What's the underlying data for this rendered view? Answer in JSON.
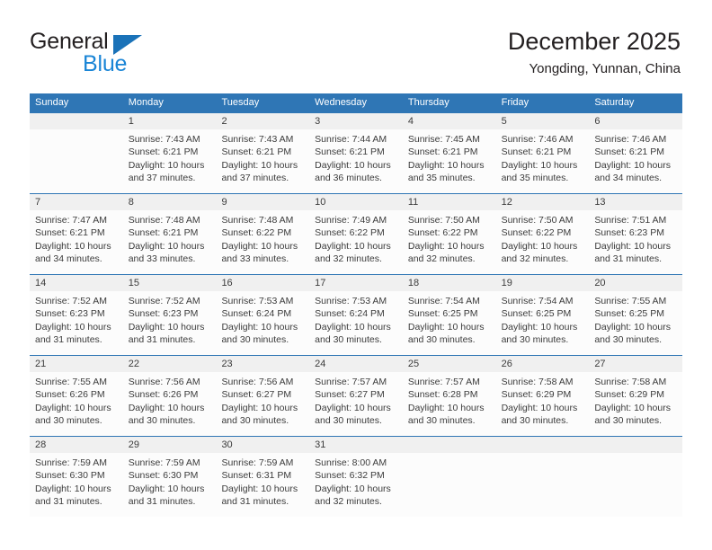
{
  "brand": {
    "name_part1": "General",
    "name_part2": "Blue",
    "triangle_color": "#1a72b8",
    "blue_color": "#1a85d6"
  },
  "header": {
    "title": "December 2025",
    "subtitle": "Yongding, Yunnan, China"
  },
  "theme": {
    "header_bg": "#2f76b5",
    "daynum_bg": "#f0f0f0",
    "cell_bg": "#fcfcfc",
    "text_color": "#3b3b3b"
  },
  "weekdays": [
    "Sunday",
    "Monday",
    "Tuesday",
    "Wednesday",
    "Thursday",
    "Friday",
    "Saturday"
  ],
  "weeks": [
    {
      "days": [
        {
          "number": "",
          "sunrise": "",
          "sunset": "",
          "daylight_line1": "",
          "daylight_line2": ""
        },
        {
          "number": "1",
          "sunrise": "Sunrise: 7:43 AM",
          "sunset": "Sunset: 6:21 PM",
          "daylight_line1": "Daylight: 10 hours",
          "daylight_line2": "and 37 minutes."
        },
        {
          "number": "2",
          "sunrise": "Sunrise: 7:43 AM",
          "sunset": "Sunset: 6:21 PM",
          "daylight_line1": "Daylight: 10 hours",
          "daylight_line2": "and 37 minutes."
        },
        {
          "number": "3",
          "sunrise": "Sunrise: 7:44 AM",
          "sunset": "Sunset: 6:21 PM",
          "daylight_line1": "Daylight: 10 hours",
          "daylight_line2": "and 36 minutes."
        },
        {
          "number": "4",
          "sunrise": "Sunrise: 7:45 AM",
          "sunset": "Sunset: 6:21 PM",
          "daylight_line1": "Daylight: 10 hours",
          "daylight_line2": "and 35 minutes."
        },
        {
          "number": "5",
          "sunrise": "Sunrise: 7:46 AM",
          "sunset": "Sunset: 6:21 PM",
          "daylight_line1": "Daylight: 10 hours",
          "daylight_line2": "and 35 minutes."
        },
        {
          "number": "6",
          "sunrise": "Sunrise: 7:46 AM",
          "sunset": "Sunset: 6:21 PM",
          "daylight_line1": "Daylight: 10 hours",
          "daylight_line2": "and 34 minutes."
        }
      ]
    },
    {
      "days": [
        {
          "number": "7",
          "sunrise": "Sunrise: 7:47 AM",
          "sunset": "Sunset: 6:21 PM",
          "daylight_line1": "Daylight: 10 hours",
          "daylight_line2": "and 34 minutes."
        },
        {
          "number": "8",
          "sunrise": "Sunrise: 7:48 AM",
          "sunset": "Sunset: 6:21 PM",
          "daylight_line1": "Daylight: 10 hours",
          "daylight_line2": "and 33 minutes."
        },
        {
          "number": "9",
          "sunrise": "Sunrise: 7:48 AM",
          "sunset": "Sunset: 6:22 PM",
          "daylight_line1": "Daylight: 10 hours",
          "daylight_line2": "and 33 minutes."
        },
        {
          "number": "10",
          "sunrise": "Sunrise: 7:49 AM",
          "sunset": "Sunset: 6:22 PM",
          "daylight_line1": "Daylight: 10 hours",
          "daylight_line2": "and 32 minutes."
        },
        {
          "number": "11",
          "sunrise": "Sunrise: 7:50 AM",
          "sunset": "Sunset: 6:22 PM",
          "daylight_line1": "Daylight: 10 hours",
          "daylight_line2": "and 32 minutes."
        },
        {
          "number": "12",
          "sunrise": "Sunrise: 7:50 AM",
          "sunset": "Sunset: 6:22 PM",
          "daylight_line1": "Daylight: 10 hours",
          "daylight_line2": "and 32 minutes."
        },
        {
          "number": "13",
          "sunrise": "Sunrise: 7:51 AM",
          "sunset": "Sunset: 6:23 PM",
          "daylight_line1": "Daylight: 10 hours",
          "daylight_line2": "and 31 minutes."
        }
      ]
    },
    {
      "days": [
        {
          "number": "14",
          "sunrise": "Sunrise: 7:52 AM",
          "sunset": "Sunset: 6:23 PM",
          "daylight_line1": "Daylight: 10 hours",
          "daylight_line2": "and 31 minutes."
        },
        {
          "number": "15",
          "sunrise": "Sunrise: 7:52 AM",
          "sunset": "Sunset: 6:23 PM",
          "daylight_line1": "Daylight: 10 hours",
          "daylight_line2": "and 31 minutes."
        },
        {
          "number": "16",
          "sunrise": "Sunrise: 7:53 AM",
          "sunset": "Sunset: 6:24 PM",
          "daylight_line1": "Daylight: 10 hours",
          "daylight_line2": "and 30 minutes."
        },
        {
          "number": "17",
          "sunrise": "Sunrise: 7:53 AM",
          "sunset": "Sunset: 6:24 PM",
          "daylight_line1": "Daylight: 10 hours",
          "daylight_line2": "and 30 minutes."
        },
        {
          "number": "18",
          "sunrise": "Sunrise: 7:54 AM",
          "sunset": "Sunset: 6:25 PM",
          "daylight_line1": "Daylight: 10 hours",
          "daylight_line2": "and 30 minutes."
        },
        {
          "number": "19",
          "sunrise": "Sunrise: 7:54 AM",
          "sunset": "Sunset: 6:25 PM",
          "daylight_line1": "Daylight: 10 hours",
          "daylight_line2": "and 30 minutes."
        },
        {
          "number": "20",
          "sunrise": "Sunrise: 7:55 AM",
          "sunset": "Sunset: 6:25 PM",
          "daylight_line1": "Daylight: 10 hours",
          "daylight_line2": "and 30 minutes."
        }
      ]
    },
    {
      "days": [
        {
          "number": "21",
          "sunrise": "Sunrise: 7:55 AM",
          "sunset": "Sunset: 6:26 PM",
          "daylight_line1": "Daylight: 10 hours",
          "daylight_line2": "and 30 minutes."
        },
        {
          "number": "22",
          "sunrise": "Sunrise: 7:56 AM",
          "sunset": "Sunset: 6:26 PM",
          "daylight_line1": "Daylight: 10 hours",
          "daylight_line2": "and 30 minutes."
        },
        {
          "number": "23",
          "sunrise": "Sunrise: 7:56 AM",
          "sunset": "Sunset: 6:27 PM",
          "daylight_line1": "Daylight: 10 hours",
          "daylight_line2": "and 30 minutes."
        },
        {
          "number": "24",
          "sunrise": "Sunrise: 7:57 AM",
          "sunset": "Sunset: 6:27 PM",
          "daylight_line1": "Daylight: 10 hours",
          "daylight_line2": "and 30 minutes."
        },
        {
          "number": "25",
          "sunrise": "Sunrise: 7:57 AM",
          "sunset": "Sunset: 6:28 PM",
          "daylight_line1": "Daylight: 10 hours",
          "daylight_line2": "and 30 minutes."
        },
        {
          "number": "26",
          "sunrise": "Sunrise: 7:58 AM",
          "sunset": "Sunset: 6:29 PM",
          "daylight_line1": "Daylight: 10 hours",
          "daylight_line2": "and 30 minutes."
        },
        {
          "number": "27",
          "sunrise": "Sunrise: 7:58 AM",
          "sunset": "Sunset: 6:29 PM",
          "daylight_line1": "Daylight: 10 hours",
          "daylight_line2": "and 30 minutes."
        }
      ]
    },
    {
      "days": [
        {
          "number": "28",
          "sunrise": "Sunrise: 7:59 AM",
          "sunset": "Sunset: 6:30 PM",
          "daylight_line1": "Daylight: 10 hours",
          "daylight_line2": "and 31 minutes."
        },
        {
          "number": "29",
          "sunrise": "Sunrise: 7:59 AM",
          "sunset": "Sunset: 6:30 PM",
          "daylight_line1": "Daylight: 10 hours",
          "daylight_line2": "and 31 minutes."
        },
        {
          "number": "30",
          "sunrise": "Sunrise: 7:59 AM",
          "sunset": "Sunset: 6:31 PM",
          "daylight_line1": "Daylight: 10 hours",
          "daylight_line2": "and 31 minutes."
        },
        {
          "number": "31",
          "sunrise": "Sunrise: 8:00 AM",
          "sunset": "Sunset: 6:32 PM",
          "daylight_line1": "Daylight: 10 hours",
          "daylight_line2": "and 32 minutes."
        },
        {
          "number": "",
          "sunrise": "",
          "sunset": "",
          "daylight_line1": "",
          "daylight_line2": ""
        },
        {
          "number": "",
          "sunrise": "",
          "sunset": "",
          "daylight_line1": "",
          "daylight_line2": ""
        },
        {
          "number": "",
          "sunrise": "",
          "sunset": "",
          "daylight_line1": "",
          "daylight_line2": ""
        }
      ]
    }
  ]
}
